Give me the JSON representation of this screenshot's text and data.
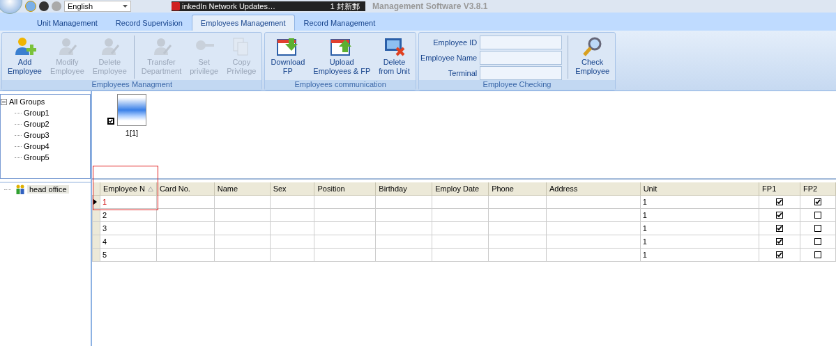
{
  "quick_access": {
    "language": "English"
  },
  "notification": {
    "text": "inkedIn Network Updates…",
    "count": "1 封新郵"
  },
  "window": {
    "title": "Management Software V3.8.1"
  },
  "tabs": [
    {
      "label": "Unit Management",
      "selected": false
    },
    {
      "label": "Record Supervision",
      "selected": false
    },
    {
      "label": "Employees Management",
      "selected": true
    },
    {
      "label": "Record Management",
      "selected": false
    }
  ],
  "ribbon_groups": [
    {
      "title": "Employees Managment",
      "buttons": [
        {
          "kind": "add-person",
          "lines": [
            "Add",
            "Employee"
          ],
          "disabled": false
        },
        {
          "kind": "edit-person",
          "lines": [
            "Modify",
            "Employee"
          ],
          "disabled": true
        },
        {
          "kind": "delete-person",
          "lines": [
            "Delete",
            "Employee"
          ],
          "disabled": true
        },
        {
          "kind": "transfer",
          "lines": [
            "Transfer",
            "Department"
          ],
          "disabled": true,
          "separator_before": true
        },
        {
          "kind": "privilege",
          "lines": [
            "Set",
            "privilege"
          ],
          "disabled": true
        },
        {
          "kind": "copy",
          "lines": [
            "Copy",
            "Privilege"
          ],
          "disabled": true
        }
      ]
    },
    {
      "title": "Employees communication",
      "buttons": [
        {
          "kind": "download",
          "lines": [
            "Download",
            "FP"
          ],
          "disabled": false
        },
        {
          "kind": "upload",
          "lines": [
            "Upload",
            "Employees & FP"
          ],
          "disabled": false
        },
        {
          "kind": "delete-unit",
          "lines": [
            "Delete",
            "from Unit"
          ],
          "disabled": false
        }
      ]
    },
    {
      "title": "Employee Checking",
      "fields": [
        {
          "label": "Employee ID"
        },
        {
          "label": "Employee Name"
        },
        {
          "label": "Terminal"
        }
      ],
      "buttons": [
        {
          "kind": "search",
          "lines": [
            "Check",
            "Employee"
          ],
          "disabled": false,
          "separator_before": true
        }
      ]
    }
  ],
  "group_tree": {
    "label": "All Groups",
    "expanded": true,
    "children": [
      {
        "label": "Group1"
      },
      {
        "label": "Group2"
      },
      {
        "label": "Group3"
      },
      {
        "label": "Group4"
      },
      {
        "label": "Group5"
      }
    ]
  },
  "unit_tree": [
    {
      "label": "head office",
      "selected": true
    }
  ],
  "thumbnails": [
    {
      "label": "1[1]",
      "checked": true
    }
  ],
  "table": {
    "columns": [
      "Employee N",
      "Card No.",
      "Name",
      "Sex",
      "Position",
      "Birthday",
      "Employ Date",
      "Phone",
      "Address",
      "Unit",
      "FP1",
      "FP2"
    ],
    "rows": [
      {
        "employee_no": "1",
        "unit": "1",
        "fp1": true,
        "fp2": true,
        "selected": true
      },
      {
        "employee_no": "2",
        "unit": "1",
        "fp1": true,
        "fp2": false,
        "selected": false
      },
      {
        "employee_no": "3",
        "unit": "1",
        "fp1": true,
        "fp2": false,
        "selected": false
      },
      {
        "employee_no": "4",
        "unit": "1",
        "fp1": true,
        "fp2": false,
        "selected": false
      },
      {
        "employee_no": "5",
        "unit": "1",
        "fp1": true,
        "fp2": false,
        "selected": false
      }
    ]
  }
}
